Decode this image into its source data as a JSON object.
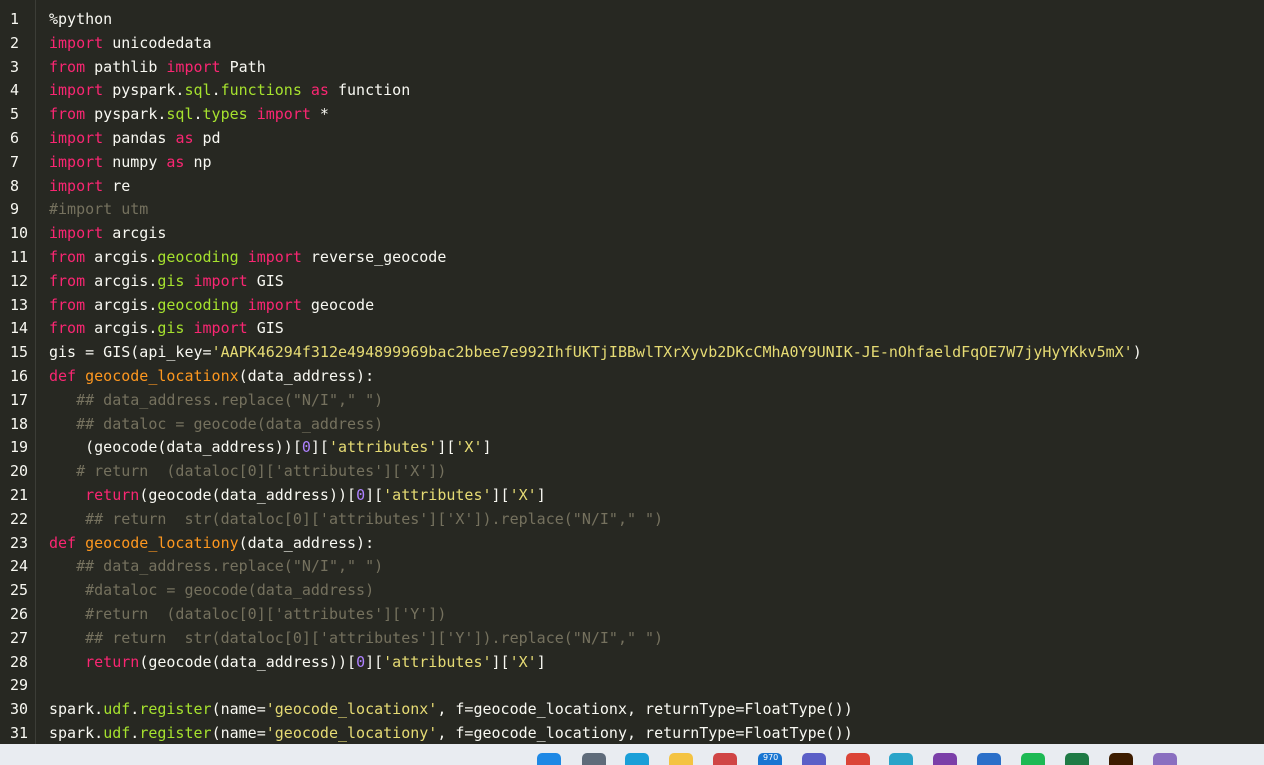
{
  "editor": {
    "line_numbers": [
      "1",
      "2",
      "3",
      "4",
      "5",
      "6",
      "7",
      "8",
      "9",
      "10",
      "11",
      "12",
      "13",
      "14",
      "15",
      "16",
      "17",
      "18",
      "19",
      "20",
      "21",
      "22",
      "23",
      "24",
      "25",
      "26",
      "27",
      "28",
      "29",
      "30",
      "31"
    ],
    "lines": [
      [
        {
          "t": "%python",
          "c": "plain"
        }
      ],
      [
        {
          "t": "import",
          "c": "keyword"
        },
        {
          "t": " unicodedata",
          "c": "plain"
        }
      ],
      [
        {
          "t": "from",
          "c": "keyword"
        },
        {
          "t": " pathlib ",
          "c": "plain"
        },
        {
          "t": "import",
          "c": "keyword"
        },
        {
          "t": " Path",
          "c": "plain"
        }
      ],
      [
        {
          "t": "import",
          "c": "keyword"
        },
        {
          "t": " pyspark.",
          "c": "plain"
        },
        {
          "t": "sql",
          "c": "attr"
        },
        {
          "t": ".",
          "c": "plain"
        },
        {
          "t": "functions",
          "c": "attr"
        },
        {
          "t": " ",
          "c": "plain"
        },
        {
          "t": "as",
          "c": "keyword"
        },
        {
          "t": " function",
          "c": "plain"
        }
      ],
      [
        {
          "t": "from",
          "c": "keyword"
        },
        {
          "t": " pyspark.",
          "c": "plain"
        },
        {
          "t": "sql",
          "c": "attr"
        },
        {
          "t": ".",
          "c": "plain"
        },
        {
          "t": "types",
          "c": "attr"
        },
        {
          "t": " ",
          "c": "plain"
        },
        {
          "t": "import",
          "c": "keyword"
        },
        {
          "t": " *",
          "c": "plain"
        }
      ],
      [
        {
          "t": "import",
          "c": "keyword"
        },
        {
          "t": " pandas ",
          "c": "plain"
        },
        {
          "t": "as",
          "c": "keyword"
        },
        {
          "t": " pd",
          "c": "plain"
        }
      ],
      [
        {
          "t": "import",
          "c": "keyword"
        },
        {
          "t": " numpy ",
          "c": "plain"
        },
        {
          "t": "as",
          "c": "keyword"
        },
        {
          "t": " np",
          "c": "plain"
        }
      ],
      [
        {
          "t": "import",
          "c": "keyword"
        },
        {
          "t": " re",
          "c": "plain"
        }
      ],
      [
        {
          "t": "#import utm",
          "c": "comment"
        }
      ],
      [
        {
          "t": "import",
          "c": "keyword"
        },
        {
          "t": " arcgis",
          "c": "plain"
        }
      ],
      [
        {
          "t": "from",
          "c": "keyword"
        },
        {
          "t": " arcgis.",
          "c": "plain"
        },
        {
          "t": "geocoding",
          "c": "attr"
        },
        {
          "t": " ",
          "c": "plain"
        },
        {
          "t": "import",
          "c": "keyword"
        },
        {
          "t": " reverse_geocode",
          "c": "plain"
        }
      ],
      [
        {
          "t": "from",
          "c": "keyword"
        },
        {
          "t": " arcgis.",
          "c": "plain"
        },
        {
          "t": "gis",
          "c": "attr"
        },
        {
          "t": " ",
          "c": "plain"
        },
        {
          "t": "import",
          "c": "keyword"
        },
        {
          "t": " GIS",
          "c": "plain"
        }
      ],
      [
        {
          "t": "from",
          "c": "keyword"
        },
        {
          "t": " arcgis.",
          "c": "plain"
        },
        {
          "t": "geocoding",
          "c": "attr"
        },
        {
          "t": " ",
          "c": "plain"
        },
        {
          "t": "import",
          "c": "keyword"
        },
        {
          "t": " geocode",
          "c": "plain"
        }
      ],
      [
        {
          "t": "from",
          "c": "keyword"
        },
        {
          "t": " arcgis.",
          "c": "plain"
        },
        {
          "t": "gis",
          "c": "attr"
        },
        {
          "t": " ",
          "c": "plain"
        },
        {
          "t": "import",
          "c": "keyword"
        },
        {
          "t": " GIS",
          "c": "plain"
        }
      ],
      [
        {
          "t": "gis = GIS(api_key=",
          "c": "plain"
        },
        {
          "t": "'AAPK46294f312e494899969bac2bbee7e992IhfUKTjIBBwlTXrXyvb2DKcCMhA0Y9UNIK-JE-nOhfaeldFqOE7W7jyHyYKkv5mX'",
          "c": "string"
        },
        {
          "t": ")",
          "c": "plain"
        }
      ],
      [
        {
          "t": "def",
          "c": "keyword"
        },
        {
          "t": " ",
          "c": "plain"
        },
        {
          "t": "geocode_locationx",
          "c": "def"
        },
        {
          "t": "(data_address):",
          "c": "plain"
        }
      ],
      [
        {
          "t": "   ## data_address.replace(\"N/I\",\" \")",
          "c": "comment"
        }
      ],
      [
        {
          "t": "   ## dataloc = geocode(data_address)",
          "c": "comment"
        }
      ],
      [
        {
          "t": "    (geocode(data_address))[",
          "c": "plain"
        },
        {
          "t": "0",
          "c": "number"
        },
        {
          "t": "][",
          "c": "plain"
        },
        {
          "t": "'attributes'",
          "c": "string"
        },
        {
          "t": "][",
          "c": "plain"
        },
        {
          "t": "'X'",
          "c": "string"
        },
        {
          "t": "]",
          "c": "plain"
        }
      ],
      [
        {
          "t": "   # return  (dataloc[0]['attributes']['X'])",
          "c": "comment"
        }
      ],
      [
        {
          "t": "    ",
          "c": "plain"
        },
        {
          "t": "return",
          "c": "keyword"
        },
        {
          "t": "(geocode(data_address))[",
          "c": "plain"
        },
        {
          "t": "0",
          "c": "number"
        },
        {
          "t": "][",
          "c": "plain"
        },
        {
          "t": "'attributes'",
          "c": "string"
        },
        {
          "t": "][",
          "c": "plain"
        },
        {
          "t": "'X'",
          "c": "string"
        },
        {
          "t": "]",
          "c": "plain"
        }
      ],
      [
        {
          "t": "    ## return  str(dataloc[0]['attributes']['X']).replace(\"N/I\",\" \")",
          "c": "comment"
        }
      ],
      [
        {
          "t": "def",
          "c": "keyword"
        },
        {
          "t": " ",
          "c": "plain"
        },
        {
          "t": "geocode_locationy",
          "c": "def"
        },
        {
          "t": "(data_address):",
          "c": "plain"
        }
      ],
      [
        {
          "t": "   ## data_address.replace(\"N/I\",\" \")",
          "c": "comment"
        }
      ],
      [
        {
          "t": "    #dataloc = geocode(data_address)",
          "c": "comment"
        }
      ],
      [
        {
          "t": "    #return  (dataloc[0]['attributes']['Y'])",
          "c": "comment"
        }
      ],
      [
        {
          "t": "    ## return  str(dataloc[0]['attributes']['Y']).replace(\"N/I\",\" \")",
          "c": "comment"
        }
      ],
      [
        {
          "t": "    ",
          "c": "plain"
        },
        {
          "t": "return",
          "c": "keyword"
        },
        {
          "t": "(geocode(data_address))[",
          "c": "plain"
        },
        {
          "t": "0",
          "c": "number"
        },
        {
          "t": "][",
          "c": "plain"
        },
        {
          "t": "'attributes'",
          "c": "string"
        },
        {
          "t": "][",
          "c": "plain"
        },
        {
          "t": "'X'",
          "c": "string"
        },
        {
          "t": "]",
          "c": "plain"
        }
      ],
      [],
      [
        {
          "t": "spark.",
          "c": "plain"
        },
        {
          "t": "udf",
          "c": "attr"
        },
        {
          "t": ".",
          "c": "plain"
        },
        {
          "t": "register",
          "c": "attr"
        },
        {
          "t": "(name=",
          "c": "plain"
        },
        {
          "t": "'geocode_locationx'",
          "c": "string"
        },
        {
          "t": ", f=geocode_locationx, returnType=FloatType())",
          "c": "plain"
        }
      ],
      [
        {
          "t": "spark.",
          "c": "plain"
        },
        {
          "t": "udf",
          "c": "attr"
        },
        {
          "t": ".",
          "c": "plain"
        },
        {
          "t": "register",
          "c": "attr"
        },
        {
          "t": "(name=",
          "c": "plain"
        },
        {
          "t": "'geocode_locationy'",
          "c": "string"
        },
        {
          "t": ", f=geocode_locationy, returnType=FloatType())",
          "c": "plain"
        }
      ]
    ]
  },
  "taskbar": {
    "icons": [
      {
        "name": "windows-start-icon",
        "color": "#1e88e5"
      },
      {
        "name": "task-view-icon",
        "color": "#5f6b7a"
      },
      {
        "name": "edge-browser-icon",
        "color": "#1a9fd8"
      },
      {
        "name": "file-explorer-icon",
        "color": "#f4c342"
      },
      {
        "name": "document-app-icon",
        "color": "#d04545"
      },
      {
        "name": "mail-app-icon",
        "color": "#1976d2"
      },
      {
        "name": "teams-icon",
        "color": "#5b5fc7"
      },
      {
        "name": "chrome-icon",
        "color": "#db4437"
      },
      {
        "name": "edge-dev-icon",
        "color": "#2aa4c9"
      },
      {
        "name": "onenote-icon",
        "color": "#7b3fa8"
      },
      {
        "name": "calendar-app-icon",
        "color": "#2b6fc9"
      },
      {
        "name": "spotify-icon",
        "color": "#1db954"
      },
      {
        "name": "excel-icon",
        "color": "#1f7a45"
      },
      {
        "name": "illustrator-icon",
        "color": "#3d1c00"
      },
      {
        "name": "other-app-icon",
        "color": "#8a6fc0"
      }
    ],
    "badge": "970"
  }
}
